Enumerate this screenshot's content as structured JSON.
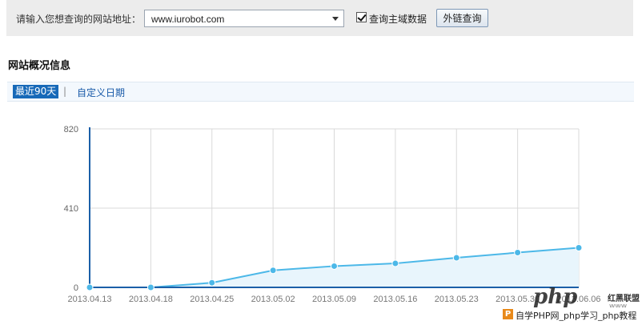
{
  "toolbar": {
    "label": "请输入您想查询的网站地址：",
    "url_value": "www.iurobot.com",
    "checkbox_label": "查询主域数据",
    "checkbox_checked": true,
    "search_button": "外链查询"
  },
  "section": {
    "title": "网站概况信息"
  },
  "tabs": {
    "active": "最近90天",
    "separator": "|",
    "custom": "自定义日期"
  },
  "chart_data": {
    "type": "area",
    "categories": [
      "2013.04.13",
      "2013.04.18",
      "2013.04.25",
      "2013.05.02",
      "2013.05.09",
      "2013.05.16",
      "2013.05.23",
      "2013.05.30",
      "2013.06.06"
    ],
    "series": [
      {
        "values": [
          0,
          0,
          24,
          88,
          110,
          124,
          153,
          180,
          205
        ]
      }
    ],
    "ylim": [
      0,
      410
    ],
    "yticks": [
      0,
      410,
      820
    ],
    "colors": {
      "line": "#4cb8e8",
      "fill": "#e8f5fc",
      "axis": "#1b5fa8",
      "grid": "#d9d9d9"
    },
    "grid": true
  },
  "watermark": {
    "logo": "php",
    "side_text": "红黑联盟",
    "side_sub": "www",
    "icon_letter": "P",
    "text": "自学PHP网_php学习_php教程"
  }
}
